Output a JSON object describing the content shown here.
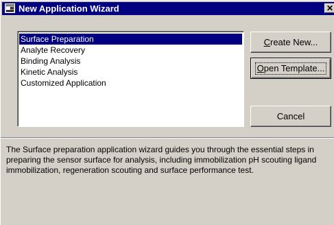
{
  "window": {
    "title": "New Application Wizard",
    "title_icon": "application-wizard-icon",
    "close_label": "✕"
  },
  "list": {
    "items": [
      {
        "label": "Surface Preparation",
        "selected": true
      },
      {
        "label": "Analyte Recovery",
        "selected": false
      },
      {
        "label": "Binding Analysis",
        "selected": false
      },
      {
        "label": "Kinetic Analysis",
        "selected": false
      },
      {
        "label": "Customized Application",
        "selected": false
      }
    ]
  },
  "buttons": {
    "create_new": {
      "before": "",
      "mnemonic": "C",
      "after": "reate New..."
    },
    "open_template": {
      "before": "",
      "mnemonic": "O",
      "after": "pen Template..."
    },
    "cancel": "Cancel"
  },
  "description": "The Surface preparation application wizard guides you through the essential steps in preparing the sensor surface for analysis, including immobilization pH scouting ligand immobilization, regeneration scouting and surface performance test.",
  "colors": {
    "dialog_face": "#d4d0c8",
    "title_bar": "#000080",
    "selection": "#000080"
  }
}
